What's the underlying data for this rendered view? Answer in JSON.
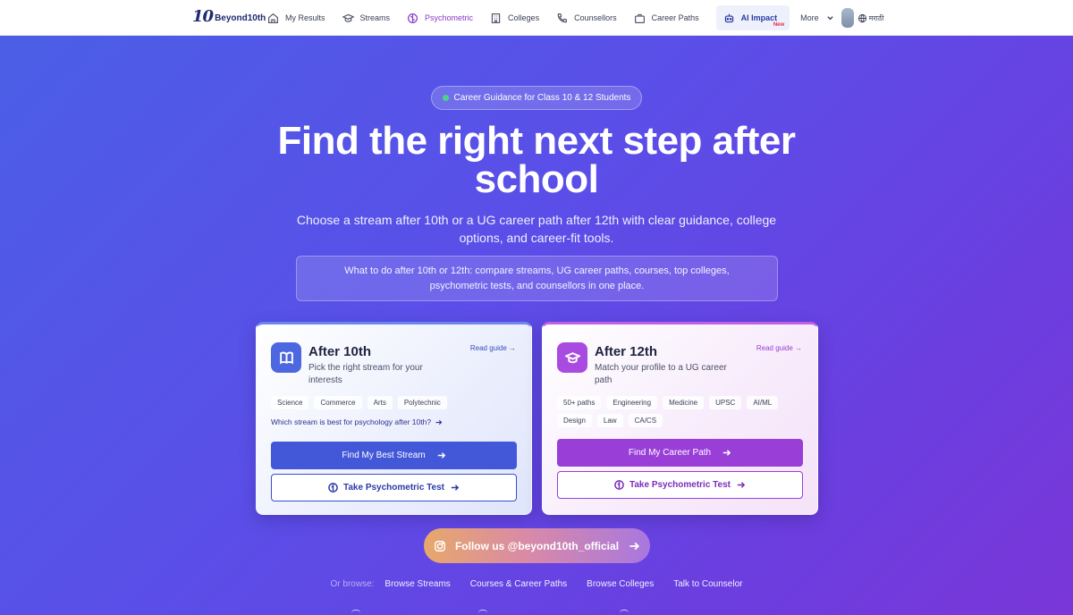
{
  "nav": {
    "logo_mark": "10",
    "logo_text": "Beyond10th",
    "items": [
      {
        "label": "My Results",
        "icon": "home-icon"
      },
      {
        "label": "Streams",
        "icon": "graduation-cap-icon"
      },
      {
        "label": "Psychometric",
        "icon": "brain-icon",
        "active": true
      },
      {
        "label": "Colleges",
        "icon": "building-icon"
      },
      {
        "label": "Counsellors",
        "icon": "phone-icon"
      },
      {
        "label": "Career Paths",
        "icon": "briefcase-icon"
      }
    ],
    "ai_label": "AI Impact",
    "ai_badge": "New",
    "more_label": "More",
    "lang_label": "मराठी"
  },
  "hero": {
    "pill": "Career Guidance for Class 10 & 12 Students",
    "headline": "Find the right next step after school",
    "subhead": "Choose a stream after 10th or a UG career path after 12th with clear guidance, college options, and career-fit tools.",
    "info": "What to do after 10th or 12th: compare streams, UG career paths, courses, top colleges, psychometric tests, and counsellors in one place."
  },
  "card1": {
    "title": "After 10th",
    "desc": "Pick the right stream for your interests",
    "read_guide": "Read guide →",
    "tags": [
      "Science",
      "Commerce",
      "Arts",
      "Polytechnic"
    ],
    "question": "Which stream is best for psychology after 10th?",
    "primary": "Find My Best Stream",
    "outline": "Take Psychometric Test"
  },
  "card2": {
    "title": "After 12th",
    "desc": "Match your profile to a UG career path",
    "read_guide": "Read guide →",
    "tags": [
      "50+ paths",
      "Engineering",
      "Medicine",
      "UPSC",
      "AI/ML",
      "Design",
      "Law",
      "CA/CS"
    ],
    "primary": "Find My Career Path",
    "outline": "Take Psychometric Test"
  },
  "follow": "Follow us @beyond10th_official",
  "browse": {
    "label": "Or browse:",
    "links": [
      "Browse Streams",
      "Courses & Career Paths",
      "Browse Colleges",
      "Talk to Counselor"
    ]
  },
  "colors": {
    "accent_blue": "#4258d8",
    "accent_purple": "#9a3ed8",
    "active_nav": "#8a3ac8"
  }
}
